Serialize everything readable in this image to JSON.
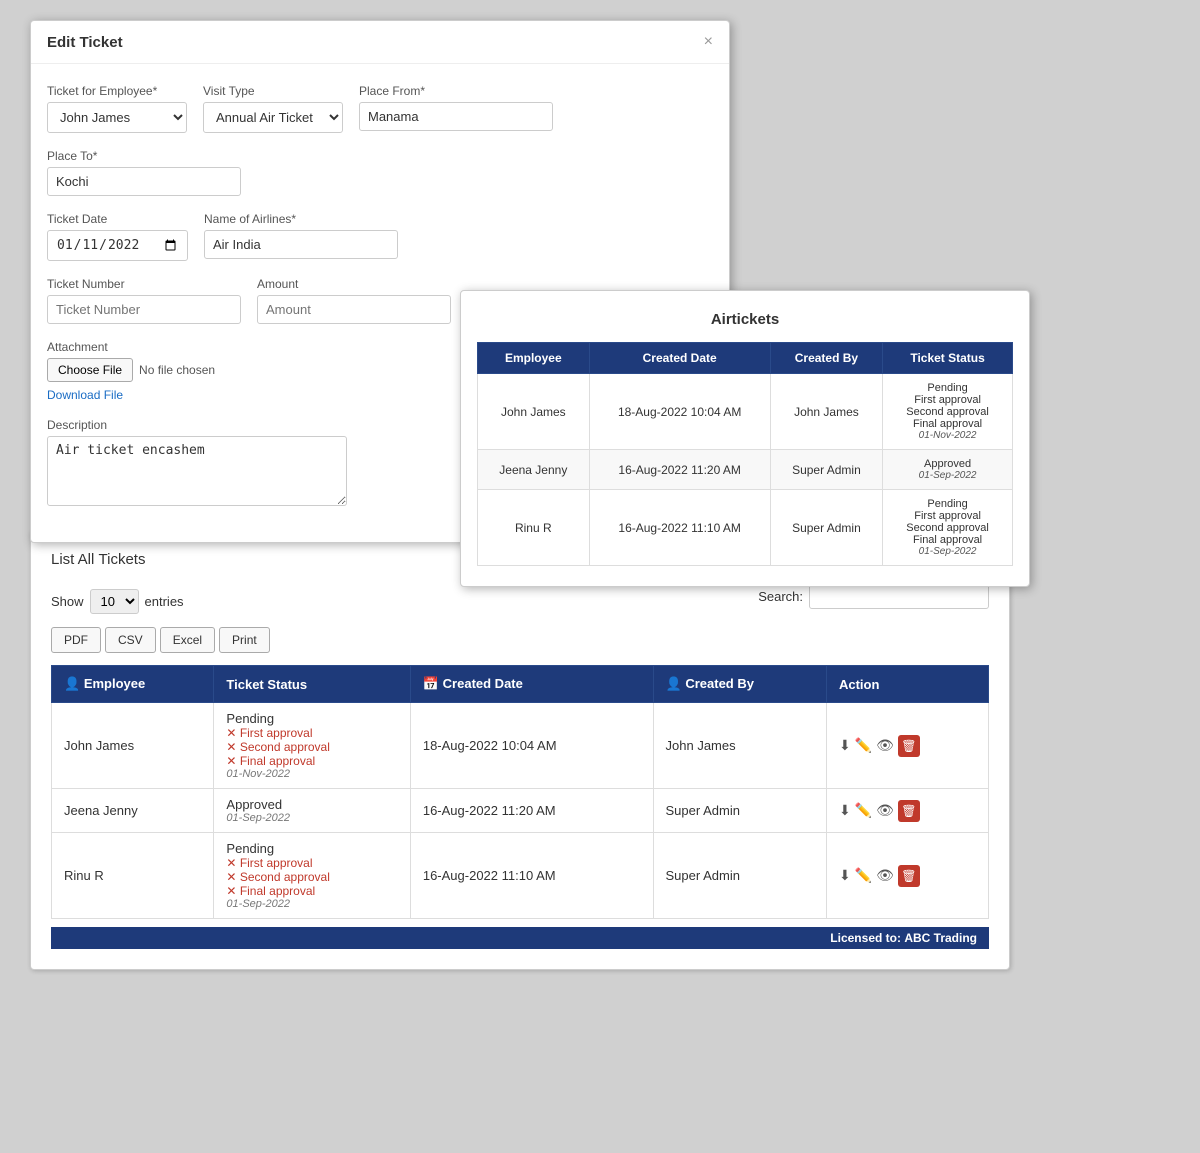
{
  "editModal": {
    "title": "Edit Ticket",
    "closeBtn": "×",
    "fields": {
      "ticketForEmployee": {
        "label": "Ticket for Employee*",
        "value": "John James"
      },
      "visitType": {
        "label": "Visit Type",
        "value": "Annual Air Ticket"
      },
      "placeFrom": {
        "label": "Place From*",
        "value": "Manama"
      },
      "placeTo": {
        "label": "Place To*",
        "value": "Kochi"
      },
      "ticketDate": {
        "label": "Ticket Date",
        "value": "01-11-2022"
      },
      "nameOfAirlines": {
        "label": "Name of Airlines*",
        "value": "Air India"
      },
      "ticketNumber": {
        "label": "Ticket Number",
        "placeholder": "Ticket Number"
      },
      "amount": {
        "label": "Amount",
        "placeholder": "Amount"
      },
      "attachment": {
        "label": "Attachment",
        "chooseFile": "Choose File",
        "noFile": "No file chosen",
        "downloadFile": "Download File"
      },
      "description": {
        "label": "Description",
        "value": "Air ticket encashem"
      }
    }
  },
  "airticketsPopup": {
    "title": "Airtickets",
    "columns": [
      "Employee",
      "Created Date",
      "Created By",
      "Ticket Status"
    ],
    "rows": [
      {
        "employee": "John James",
        "createdDate": "18-Aug-2022 10:04 AM",
        "createdBy": "John James",
        "statusLines": [
          "Pending",
          "First approval",
          "Second approval",
          "Final approval"
        ],
        "statusDate": "01-Nov-2022"
      },
      {
        "employee": "Jeena Jenny",
        "createdDate": "16-Aug-2022 11:20 AM",
        "createdBy": "Super Admin",
        "statusLines": [
          "Approved"
        ],
        "statusDate": "01-Sep-2022"
      },
      {
        "employee": "Rinu R",
        "createdDate": "16-Aug-2022 11:10 AM",
        "createdBy": "Super Admin",
        "statusLines": [
          "Pending",
          "First approval",
          "Second approval",
          "Final approval"
        ],
        "statusDate": "01-Sep-2022"
      }
    ]
  },
  "listPanel": {
    "title": "List All",
    "titleBold": "Tickets",
    "showLabel": "Show",
    "showValue": "10",
    "entriesLabel": "entries",
    "exportButtons": [
      "PDF",
      "CSV",
      "Excel",
      "Print"
    ],
    "searchLabel": "Search:",
    "searchValue": "",
    "columns": [
      "Employee",
      "Ticket Status",
      "Created Date",
      "Created By",
      "Action"
    ],
    "rows": [
      {
        "employee": "John James",
        "ticketStatus": "Pending",
        "approvals": [
          "First approval",
          "Second approval",
          "Final approval"
        ],
        "date": "01-Nov-2022",
        "createdDate": "18-Aug-2022 10:04 AM",
        "createdBy": "John James"
      },
      {
        "employee": "Jeena Jenny",
        "ticketStatus": "Approved",
        "approvals": [],
        "date": "01-Sep-2022",
        "createdDate": "16-Aug-2022 11:20 AM",
        "createdBy": "Super Admin"
      },
      {
        "employee": "Rinu R",
        "ticketStatus": "Pending",
        "approvals": [
          "First approval",
          "Second approval",
          "Final approval"
        ],
        "date": "01-Sep-2022",
        "createdDate": "16-Aug-2022 11:10 AM",
        "createdBy": "Super Admin"
      }
    ],
    "licensedText": "Licensed to:",
    "licensedName": "ABC Trading"
  }
}
